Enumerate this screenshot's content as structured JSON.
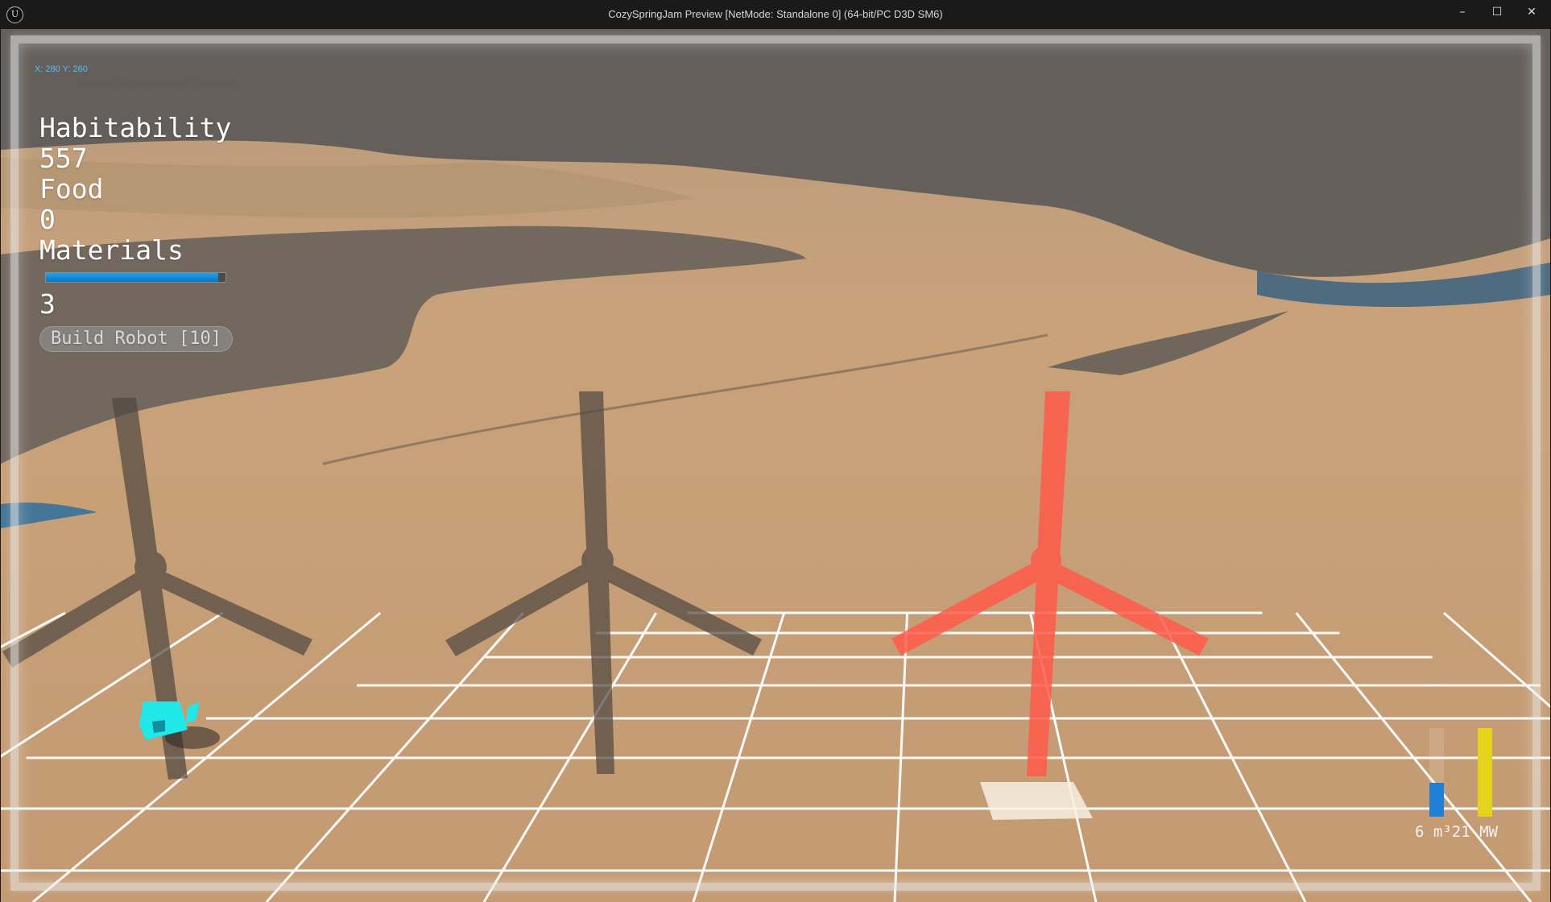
{
  "window": {
    "title": "CozySpringJam Preview [NetMode: Standalone 0]  (64-bit/PC D3D SM6)",
    "minimize_glyph": "–",
    "maximize_glyph": "☐",
    "close_glyph": "✕",
    "logo_glyph": "U"
  },
  "debug": {
    "coords": "X: 280 Y: 260",
    "message": "DisableAllScreenMessages' to suppress"
  },
  "hud": {
    "habitability_label": "Habitability",
    "habitability_value": "557",
    "food_label": "Food",
    "food_value": "0",
    "materials_label": "Materials",
    "materials_progress": 0.96,
    "materials_value": "3",
    "build_button_label": "Build Robot [10]"
  },
  "gauges": {
    "water_fill": 0.38,
    "power_fill": 1.0,
    "label": "6 m³21  MW",
    "water_color": "#1d7fd6",
    "power_color": "#e5d21a"
  },
  "colors": {
    "sand": "#c9a27b",
    "rock": "#5b5856",
    "ghost_turbine": "#ff5a4a",
    "grid": "#ffffff",
    "robot": "#20e8e8"
  }
}
